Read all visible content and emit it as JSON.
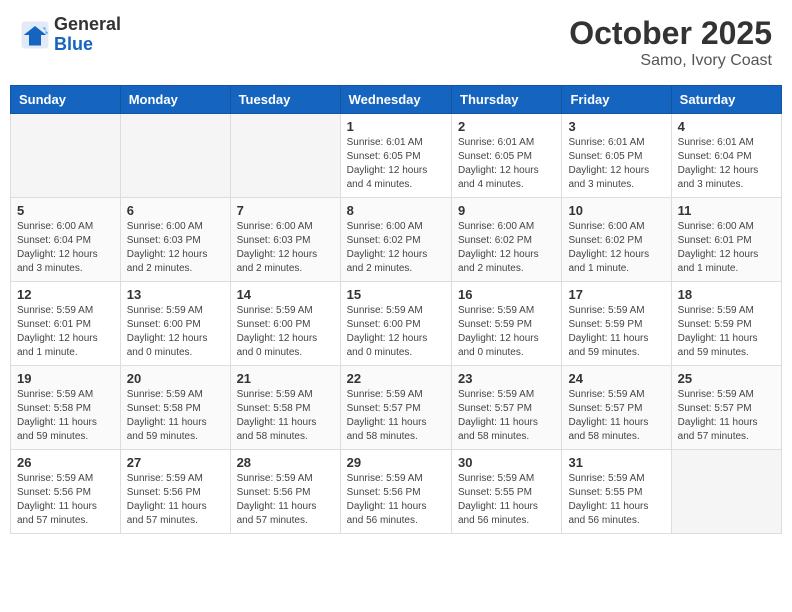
{
  "header": {
    "logo_general": "General",
    "logo_blue": "Blue",
    "month": "October 2025",
    "location": "Samo, Ivory Coast"
  },
  "weekdays": [
    "Sunday",
    "Monday",
    "Tuesday",
    "Wednesday",
    "Thursday",
    "Friday",
    "Saturday"
  ],
  "weeks": [
    [
      {
        "day": "",
        "info": ""
      },
      {
        "day": "",
        "info": ""
      },
      {
        "day": "",
        "info": ""
      },
      {
        "day": "1",
        "info": "Sunrise: 6:01 AM\nSunset: 6:05 PM\nDaylight: 12 hours\nand 4 minutes."
      },
      {
        "day": "2",
        "info": "Sunrise: 6:01 AM\nSunset: 6:05 PM\nDaylight: 12 hours\nand 4 minutes."
      },
      {
        "day": "3",
        "info": "Sunrise: 6:01 AM\nSunset: 6:05 PM\nDaylight: 12 hours\nand 3 minutes."
      },
      {
        "day": "4",
        "info": "Sunrise: 6:01 AM\nSunset: 6:04 PM\nDaylight: 12 hours\nand 3 minutes."
      }
    ],
    [
      {
        "day": "5",
        "info": "Sunrise: 6:00 AM\nSunset: 6:04 PM\nDaylight: 12 hours\nand 3 minutes."
      },
      {
        "day": "6",
        "info": "Sunrise: 6:00 AM\nSunset: 6:03 PM\nDaylight: 12 hours\nand 2 minutes."
      },
      {
        "day": "7",
        "info": "Sunrise: 6:00 AM\nSunset: 6:03 PM\nDaylight: 12 hours\nand 2 minutes."
      },
      {
        "day": "8",
        "info": "Sunrise: 6:00 AM\nSunset: 6:02 PM\nDaylight: 12 hours\nand 2 minutes."
      },
      {
        "day": "9",
        "info": "Sunrise: 6:00 AM\nSunset: 6:02 PM\nDaylight: 12 hours\nand 2 minutes."
      },
      {
        "day": "10",
        "info": "Sunrise: 6:00 AM\nSunset: 6:02 PM\nDaylight: 12 hours\nand 1 minute."
      },
      {
        "day": "11",
        "info": "Sunrise: 6:00 AM\nSunset: 6:01 PM\nDaylight: 12 hours\nand 1 minute."
      }
    ],
    [
      {
        "day": "12",
        "info": "Sunrise: 5:59 AM\nSunset: 6:01 PM\nDaylight: 12 hours\nand 1 minute."
      },
      {
        "day": "13",
        "info": "Sunrise: 5:59 AM\nSunset: 6:00 PM\nDaylight: 12 hours\nand 0 minutes."
      },
      {
        "day": "14",
        "info": "Sunrise: 5:59 AM\nSunset: 6:00 PM\nDaylight: 12 hours\nand 0 minutes."
      },
      {
        "day": "15",
        "info": "Sunrise: 5:59 AM\nSunset: 6:00 PM\nDaylight: 12 hours\nand 0 minutes."
      },
      {
        "day": "16",
        "info": "Sunrise: 5:59 AM\nSunset: 5:59 PM\nDaylight: 12 hours\nand 0 minutes."
      },
      {
        "day": "17",
        "info": "Sunrise: 5:59 AM\nSunset: 5:59 PM\nDaylight: 11 hours\nand 59 minutes."
      },
      {
        "day": "18",
        "info": "Sunrise: 5:59 AM\nSunset: 5:59 PM\nDaylight: 11 hours\nand 59 minutes."
      }
    ],
    [
      {
        "day": "19",
        "info": "Sunrise: 5:59 AM\nSunset: 5:58 PM\nDaylight: 11 hours\nand 59 minutes."
      },
      {
        "day": "20",
        "info": "Sunrise: 5:59 AM\nSunset: 5:58 PM\nDaylight: 11 hours\nand 59 minutes."
      },
      {
        "day": "21",
        "info": "Sunrise: 5:59 AM\nSunset: 5:58 PM\nDaylight: 11 hours\nand 58 minutes."
      },
      {
        "day": "22",
        "info": "Sunrise: 5:59 AM\nSunset: 5:57 PM\nDaylight: 11 hours\nand 58 minutes."
      },
      {
        "day": "23",
        "info": "Sunrise: 5:59 AM\nSunset: 5:57 PM\nDaylight: 11 hours\nand 58 minutes."
      },
      {
        "day": "24",
        "info": "Sunrise: 5:59 AM\nSunset: 5:57 PM\nDaylight: 11 hours\nand 58 minutes."
      },
      {
        "day": "25",
        "info": "Sunrise: 5:59 AM\nSunset: 5:57 PM\nDaylight: 11 hours\nand 57 minutes."
      }
    ],
    [
      {
        "day": "26",
        "info": "Sunrise: 5:59 AM\nSunset: 5:56 PM\nDaylight: 11 hours\nand 57 minutes."
      },
      {
        "day": "27",
        "info": "Sunrise: 5:59 AM\nSunset: 5:56 PM\nDaylight: 11 hours\nand 57 minutes."
      },
      {
        "day": "28",
        "info": "Sunrise: 5:59 AM\nSunset: 5:56 PM\nDaylight: 11 hours\nand 57 minutes."
      },
      {
        "day": "29",
        "info": "Sunrise: 5:59 AM\nSunset: 5:56 PM\nDaylight: 11 hours\nand 56 minutes."
      },
      {
        "day": "30",
        "info": "Sunrise: 5:59 AM\nSunset: 5:55 PM\nDaylight: 11 hours\nand 56 minutes."
      },
      {
        "day": "31",
        "info": "Sunrise: 5:59 AM\nSunset: 5:55 PM\nDaylight: 11 hours\nand 56 minutes."
      },
      {
        "day": "",
        "info": ""
      }
    ]
  ]
}
